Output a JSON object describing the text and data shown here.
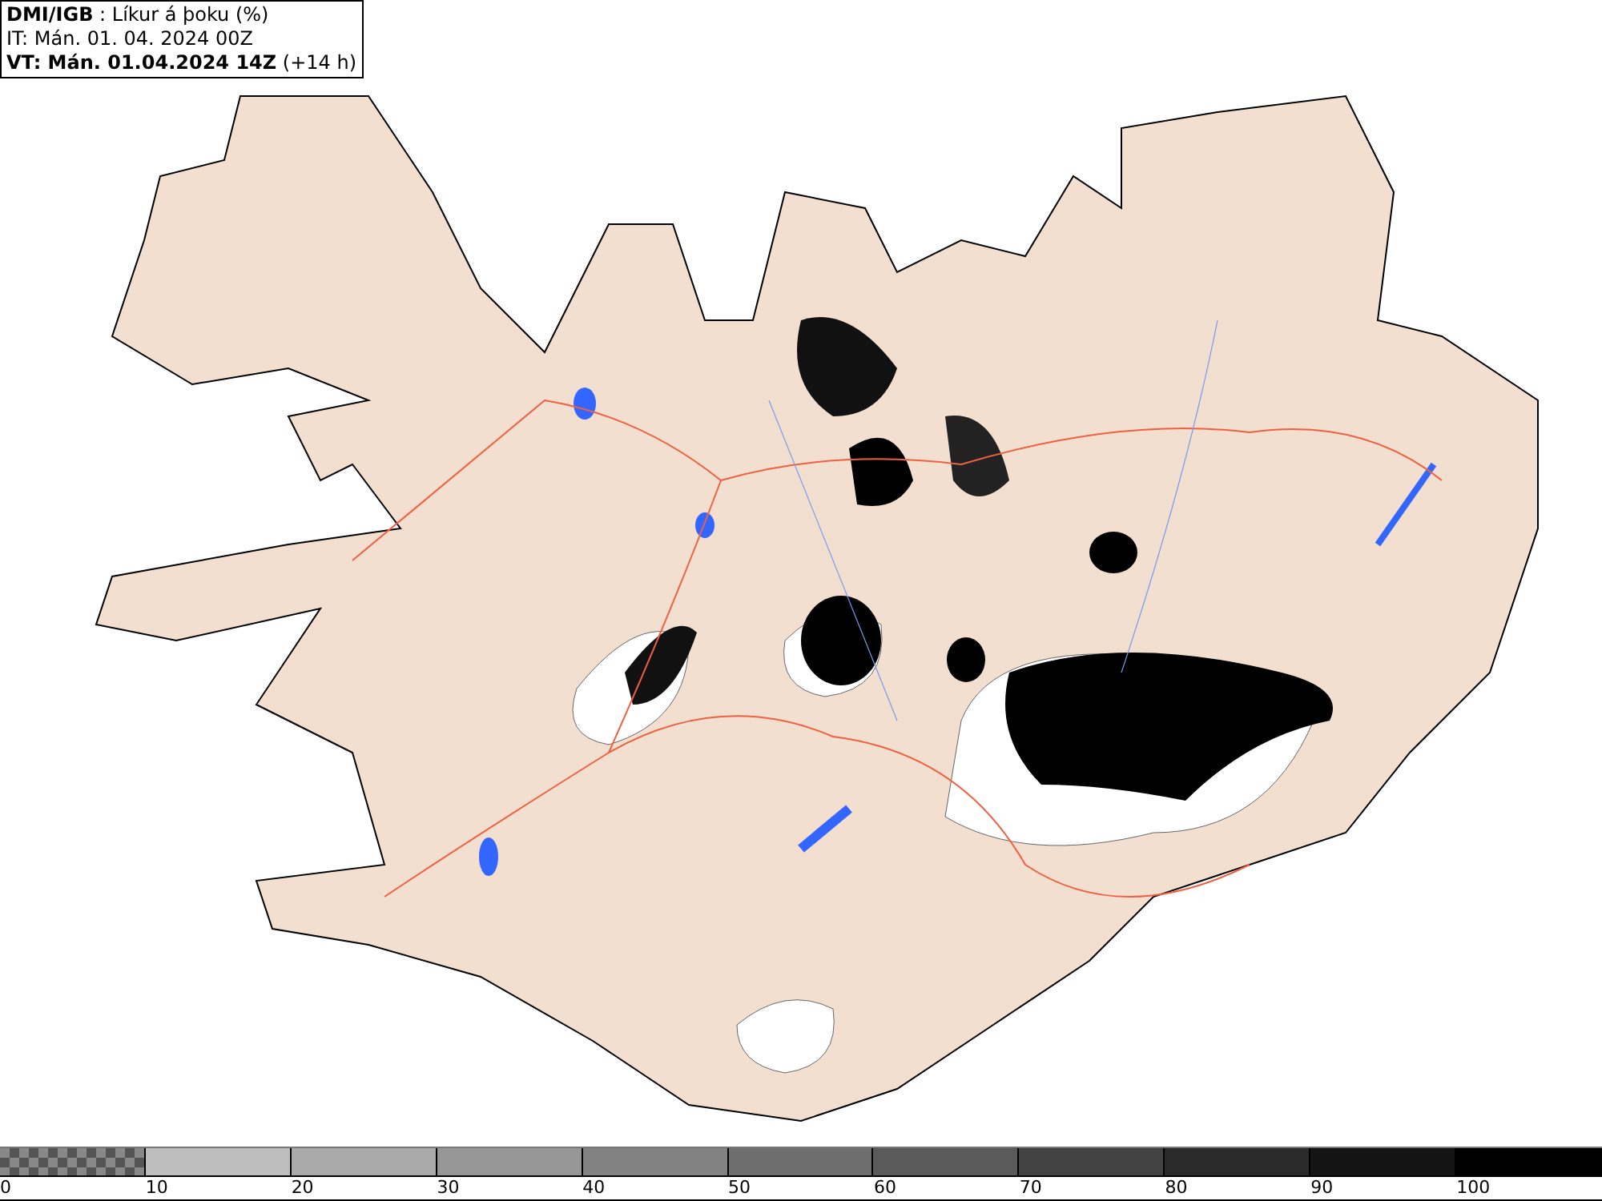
{
  "title_box": {
    "lines": [
      "**DMI/IGB** : Líkur á þoku (%)",
      "IT: Mán. 01. 04. 2024 00Z",
      "**VT: Mán. 01.04.2024 14Z** (+14 h)"
    ]
  },
  "legend": {
    "bins": [
      {
        "kind": "checkered",
        "label": "0"
      },
      {
        "kind": "solid",
        "color": "#bebebe",
        "label": "10"
      },
      {
        "kind": "solid",
        "color": "#aaaaaa",
        "label": "20"
      },
      {
        "kind": "solid",
        "color": "#969696",
        "label": "30"
      },
      {
        "kind": "solid",
        "color": "#828282",
        "label": "40"
      },
      {
        "kind": "solid",
        "color": "#6e6e6e",
        "label": "50"
      },
      {
        "kind": "solid",
        "color": "#5a5a5a",
        "label": "60"
      },
      {
        "kind": "solid",
        "color": "#424242",
        "label": "70"
      },
      {
        "kind": "solid",
        "color": "#2a2a2a",
        "label": "80"
      },
      {
        "kind": "solid",
        "color": "#141414",
        "label": "90"
      },
      {
        "kind": "solid",
        "color": "#000000",
        "label": "100"
      }
    ]
  }
}
